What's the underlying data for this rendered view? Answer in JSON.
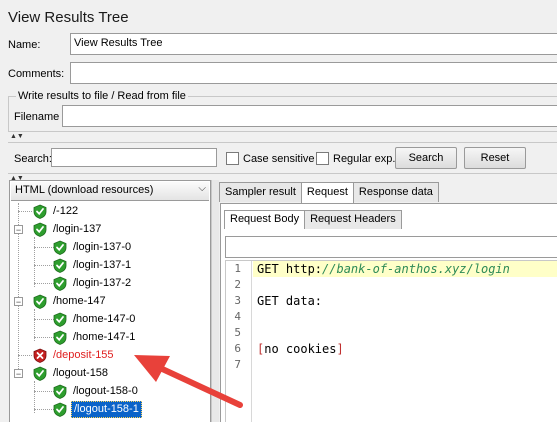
{
  "window": {
    "title": "View Results Tree"
  },
  "form": {
    "name_label": "Name:",
    "name_value": "View Results Tree",
    "comments_label": "Comments:",
    "comments_value": "",
    "file_group_label": "Write results to file / Read from file",
    "filename_label": "Filename",
    "filename_value": ""
  },
  "search": {
    "label": "Search:",
    "value": "",
    "case_sensitive_label": "Case sensitive",
    "case_sensitive_checked": false,
    "regex_label": "Regular exp.",
    "regex_checked": false,
    "search_button": "Search",
    "reset_button": "Reset"
  },
  "renderer": {
    "selected": "HTML (download resources)"
  },
  "tree": {
    "items": [
      {
        "label": "/-122",
        "status": "success"
      },
      {
        "label": "/login-137",
        "status": "success",
        "expanded": true
      },
      {
        "label": "/login-137-0",
        "status": "success"
      },
      {
        "label": "/login-137-1",
        "status": "success"
      },
      {
        "label": "/login-137-2",
        "status": "success"
      },
      {
        "label": "/home-147",
        "status": "success",
        "expanded": true
      },
      {
        "label": "/home-147-0",
        "status": "success"
      },
      {
        "label": "/home-147-1",
        "status": "success"
      },
      {
        "label": "/deposit-155",
        "status": "error"
      },
      {
        "label": "/logout-158",
        "status": "success",
        "expanded": true
      },
      {
        "label": "/logout-158-0",
        "status": "success"
      },
      {
        "label": "/logout-158-1",
        "status": "success",
        "selected": true
      }
    ]
  },
  "result_tabs": [
    "Sampler result",
    "Request",
    "Response data"
  ],
  "result_tabs_active": "Request",
  "request_tabs": [
    "Request Body",
    "Request Headers"
  ],
  "request_tabs_active": "Request Body",
  "code": {
    "line_numbers": [
      "1",
      "2",
      "3",
      "4",
      "5",
      "6",
      "7"
    ],
    "line1_method": "GET ",
    "line1_scheme": "http:",
    "line1_url": "//bank-of-anthos.xyz/login",
    "line3": "GET data:",
    "line6_open": "[",
    "line6_text": "no cookies",
    "line6_close": "]"
  },
  "colors": {
    "error_text": "#e02020",
    "selection": "#0a63c9",
    "annotation_arrow": "#e8413a",
    "success_icon": "#2e9e2e",
    "error_icon": "#c42020"
  }
}
